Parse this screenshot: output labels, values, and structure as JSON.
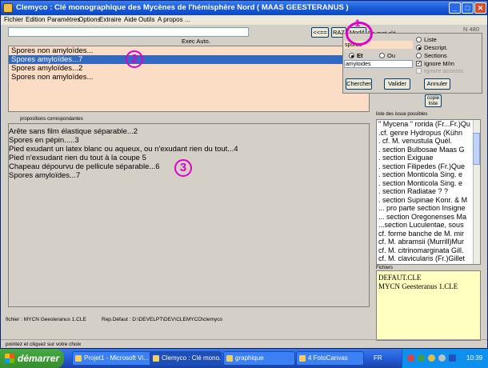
{
  "window": {
    "title": "Clemyco :  Clé monographique des Mycènes de l'hémisphère Nord ( MAAS GEESTERANUS )",
    "min": "_",
    "max": "□",
    "close": "✕"
  },
  "menu": [
    "Fichier",
    "Edition",
    "Paramètres",
    "Options",
    "Extraire",
    "Aide",
    "Outils",
    "A propos ..."
  ],
  "toolbar": {
    "search_value": "",
    "nav_btn": "<<==",
    "raz_btn": "RAZ",
    "mode_btn": "Modif",
    "mot_cle_label": "Ps mot clé",
    "n_label": "N 480",
    "exec_label": "Exec Auto."
  },
  "popup": {
    "field1": "spores",
    "et_label": "Et",
    "ou_label": "Ou",
    "field2": "amyloides",
    "options": [
      "Liste",
      "Descript.",
      "Sections"
    ],
    "ignore_mm": "Ignore M/m",
    "ignore_accents": "Ignore accents",
    "chercher": "Chercher",
    "valider": "Valider",
    "annuler": "Annuler"
  },
  "copie_btn": "copie liste",
  "list1": {
    "rows": [
      "Spores non amyloïdes...",
      "Spores amyloïdes...7",
      "Spores amyloïdes...2",
      " Spores non amyloïdes..."
    ],
    "selected": 1
  },
  "list2": {
    "label": "propositions correspondantes",
    "rows": [
      "  Arête sans film élastique séparable...2",
      " Spores en pépin.....3",
      "   Pied exudant un latex blanc ou aqueux, ou n'exudant rien du tout...4",
      "Pied n'exsudant rien du tout à la coupe  5",
      " Chapeau dépourvu de pellicule séparable...6",
      " Spores amyloïdes...7"
    ]
  },
  "list3": {
    "label": "liste des issue possibles",
    "rows": [
      "\" Mycena \" rorida (Fr...Fr.)Qu",
      " .cf. genre Hydropus (Kühn",
      " . cf. M. venustula Quél.",
      " . section Bulbosae Maas G",
      " . section Exiguae",
      " . section Filipedes (Fr.)Que",
      " . section Monticola Sing. e",
      " . section Monticola Sing. e",
      " . section Radiatae ? ?",
      " . section Supinae Konr. & M",
      " ... pro parte section Insigne",
      " ... section Oregonenses Ma",
      " ...section Luculentae, sous",
      " cf. forme banche de M. mir",
      " cf. M. abramsii (Murrill)Mur",
      " cf. M. citrinomarginata Gill.",
      " cf. M. clavicularis (Fr.)Gillet"
    ]
  },
  "list4": {
    "label": "Fichiers",
    "rows": [
      "DEFAUT.CLE",
      "MYCN Geesteranus 1.CLE"
    ]
  },
  "status": {
    "fichier": "fichier : MYCN Geesteranus 1.CLE",
    "rep": "Rep.Défaut : D:\\DEVELPT\\DEV\\CLEMYCO\\clemyco",
    "hint": "pointez et cliquez sur votre choix"
  },
  "annotations": [
    "1",
    "2",
    "3"
  ],
  "taskbar": {
    "start": "démarrer",
    "tasks": [
      "Projet1 - Microsoft Vi...",
      "Clemyco : Clé mono...",
      "graphique",
      "4 FotoCanvas"
    ],
    "lang": "FR",
    "time": "10:39"
  },
  "colors": {
    "list1_bg": "#fbdcc4",
    "selection": "#316ac5",
    "annotation": "#e000c8",
    "files_bg": "#ffffc0"
  }
}
